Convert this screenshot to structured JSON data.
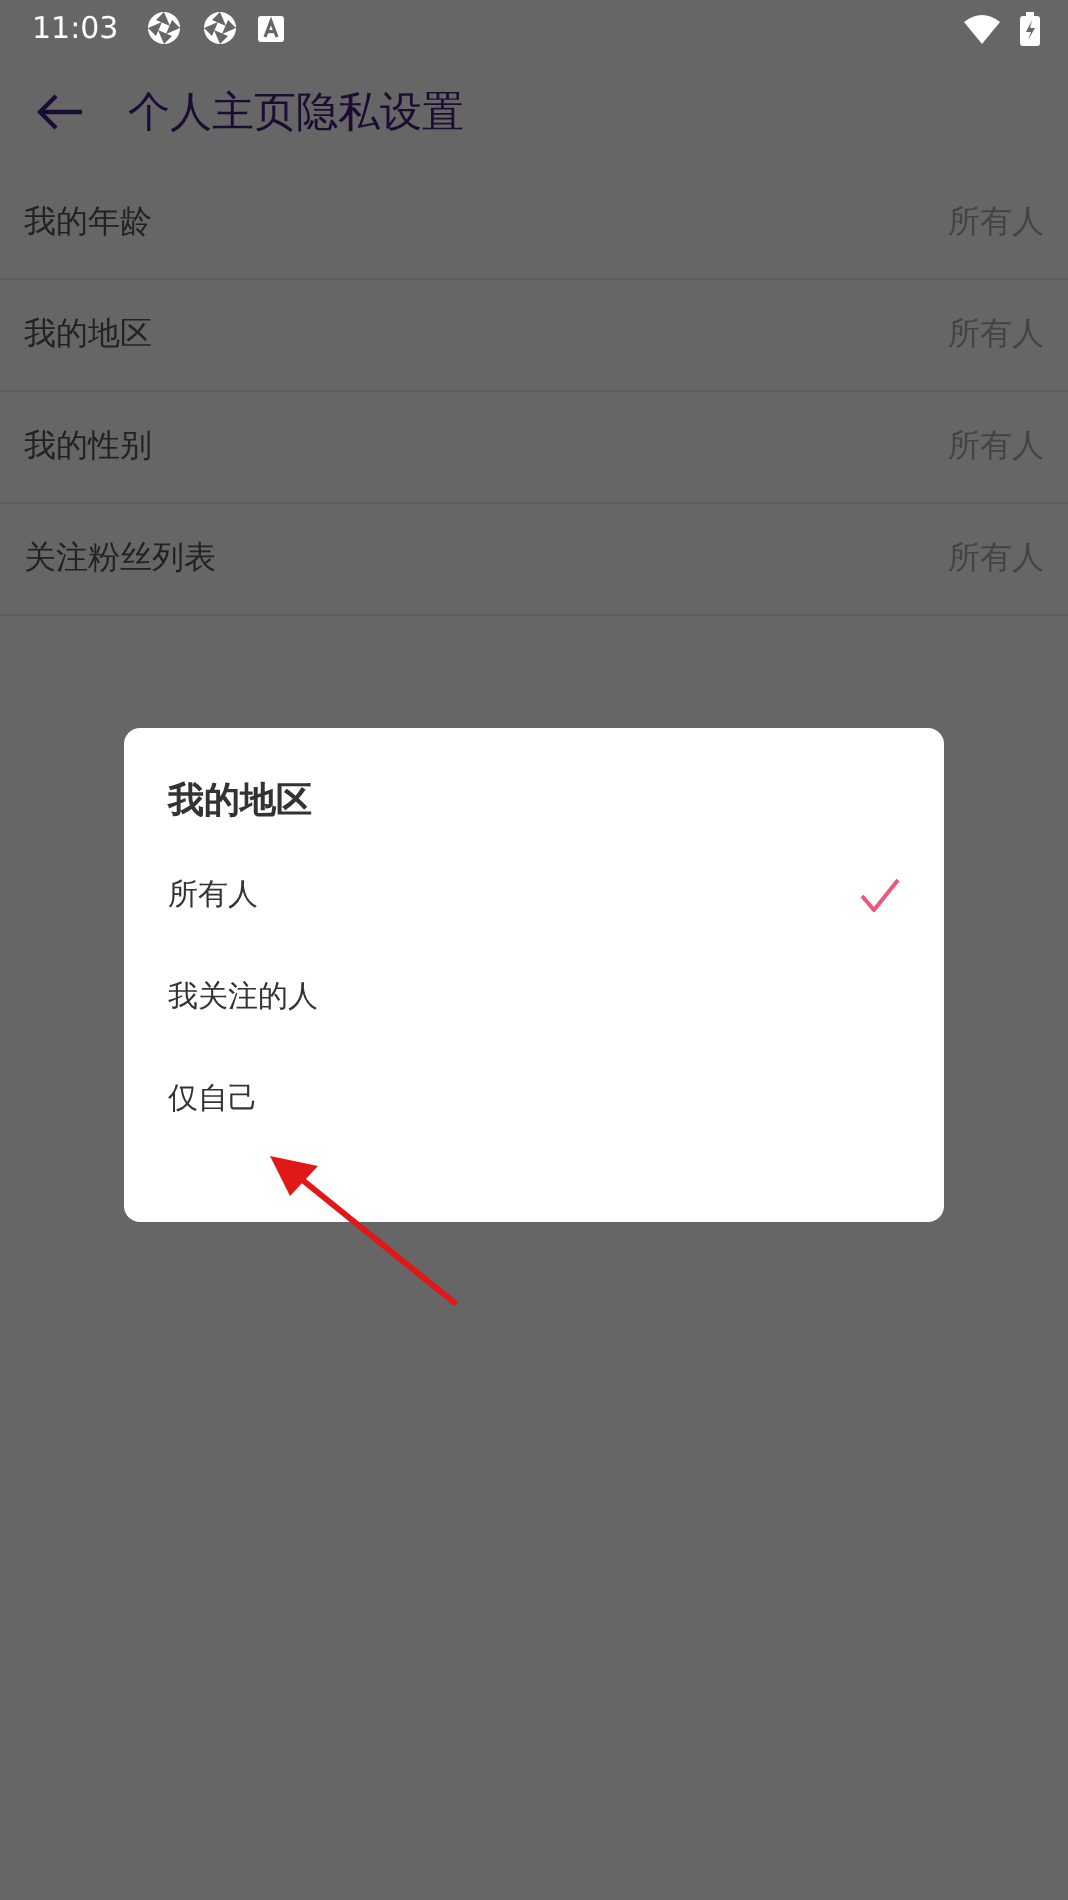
{
  "status_bar": {
    "time": "11:03"
  },
  "header": {
    "title": "个人主页隐私设置"
  },
  "settings": [
    {
      "label": "我的年龄",
      "value": "所有人"
    },
    {
      "label": "我的地区",
      "value": "所有人"
    },
    {
      "label": "我的性别",
      "value": "所有人"
    },
    {
      "label": "关注粉丝列表",
      "value": "所有人"
    }
  ],
  "dialog": {
    "title": "我的地区",
    "options": [
      {
        "label": "所有人",
        "selected": true
      },
      {
        "label": "我关注的人",
        "selected": false
      },
      {
        "label": "仅自己",
        "selected": false
      }
    ]
  }
}
